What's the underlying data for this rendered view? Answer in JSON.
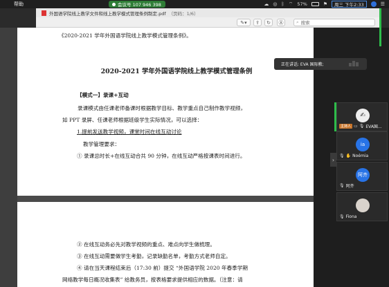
{
  "menubar": {
    "help": "帮助",
    "meeting_id": "会议号 107 946 398",
    "battery": "57%",
    "clock": "周三 下午2:33"
  },
  "window": {
    "title": "外国语学院线上教学文件和线上教学模式管理条例制定.pdf",
    "pages": "（页码：1/6）"
  },
  "toolbar": {
    "search_placeholder": "搜索"
  },
  "document": {
    "page1": {
      "header_line": "《2020-2021 学年外国语学院线上教学模式管理条例》。",
      "title": "2020-2021 学年外国语学院线上教学模式管理条例",
      "mode_heading": "【模式一】录课+互动",
      "para1_line1": "录课模式由任课老师备课时根据教学目标、教学重点自己制作教学视频，",
      "para1_line2": "如 PPT 录屏、任课老师根据班级学生实际情况，可以选择：",
      "item1": "1.提前发送教学视频，课堂时间在线互动讨论",
      "req_heading": "教学管理要求：",
      "req1": "①  录课总时长+在线互动合共 90 分钟，在线互动严格按课表时间进行。"
    },
    "page2": {
      "req2": "②  在线互动务必先对教学视频的重点、难点向学生做梳理。",
      "req3": "③  在线互动需要做学生考勤，记录缺勤名单，考勤方式老师自定。",
      "req4": "④  请在当天课程结束后（17:30 前）提交 “外国语学院 2020 年春季学期",
      "req4_line2": "网络教学每日概况收集表” 给教务员，按表格要求提供相应的数据。（注意：请"
    }
  },
  "meeting": {
    "speaking_text": "正在讲话: EVA 国际教;",
    "participants": [
      {
        "avatar": "",
        "name": "EVA国...",
        "host_badge": "主持人"
      },
      {
        "avatar": "ia",
        "name": "Noémia"
      },
      {
        "avatar": "阿齐",
        "name": "阿齐"
      },
      {
        "avatar": "",
        "name": "Fiona"
      }
    ]
  },
  "colors": {
    "accent_green": "#2ebd4a",
    "avatar_blue": "#2873e6",
    "meeting_green": "#2f7d36"
  }
}
